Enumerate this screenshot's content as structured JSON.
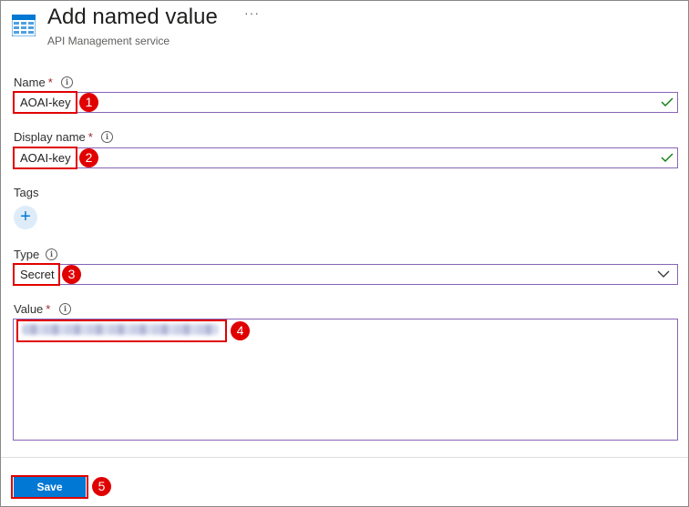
{
  "header": {
    "title": "Add named value",
    "subtitle": "API Management service",
    "more": "···"
  },
  "form": {
    "name": {
      "label": "Name",
      "required": "*",
      "value": "AOAI-key"
    },
    "display_name": {
      "label": "Display name",
      "required": "*",
      "value": "AOAI-key"
    },
    "tags": {
      "label": "Tags",
      "add": "+"
    },
    "type": {
      "label": "Type",
      "selected": "Secret"
    },
    "value": {
      "label": "Value",
      "required": "*"
    },
    "info": "i"
  },
  "footer": {
    "save_label": "Save"
  },
  "callouts": [
    "1",
    "2",
    "3",
    "4",
    "5"
  ],
  "colors": {
    "accent": "#0078d4",
    "input_border": "#8764b8",
    "valid": "#107c10",
    "callout": "#e00000"
  },
  "icons": {
    "app": "api-management-icon",
    "valid": "checkmark-icon",
    "dropdown": "chevron-down-icon"
  }
}
